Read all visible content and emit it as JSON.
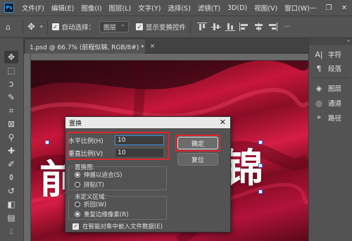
{
  "app": {
    "logo_text": "Ps"
  },
  "menu": [
    "文件(F)",
    "编辑(E)",
    "图像(I)",
    "图层(L)",
    "文字(Y)",
    "选择(S)",
    "滤镜(T)",
    "3D(D)",
    "视图(V)",
    "窗口(W)"
  ],
  "window_controls": {
    "minimize": "—",
    "restore": "❐",
    "close": "✕"
  },
  "options_bar": {
    "auto_select_label": "自动选择：",
    "auto_select_value": "图层",
    "show_transform_label": "显示变换控件"
  },
  "document_tab": {
    "title": "1.psd @ 66.7% (前程似锦, RGB/8#) *",
    "close": "×"
  },
  "canvas": {
    "left_char": "前",
    "right_char": "锦",
    "background_colors": [
      "#3a0a14",
      "#c8163a",
      "#7a0e22"
    ]
  },
  "right_panel": {
    "items": [
      {
        "icon": "character-icon",
        "glyph": "A|",
        "label": "字符"
      },
      {
        "icon": "paragraph-icon",
        "glyph": "¶",
        "label": "段落"
      },
      {
        "icon": "layers-icon",
        "glyph": "◈",
        "label": "图层"
      },
      {
        "icon": "channels-icon",
        "glyph": "◎",
        "label": "通道"
      },
      {
        "icon": "paths-icon",
        "glyph": "⌖",
        "label": "路径"
      }
    ]
  },
  "dialog": {
    "title": "置换",
    "close": "✕",
    "horizontal_label": "水平比例(H)",
    "horizontal_value": "10",
    "vertical_label": "垂直比例(V)",
    "vertical_value": "10",
    "ok_label": "确定",
    "reset_label": "复位",
    "displacement_map_title": "置换图:",
    "stretch_to_fit": "伸展以适合(S)",
    "tile": "拼贴(T)",
    "undefined_areas_title": "未定义区域:",
    "wrap_around": "折回(W)",
    "repeat_edge_pixels": "重复边缘像素(R)",
    "embed_smart_object": "在智能对象中嵌入文件数据(E)"
  },
  "highlight_color": "#e0252f"
}
